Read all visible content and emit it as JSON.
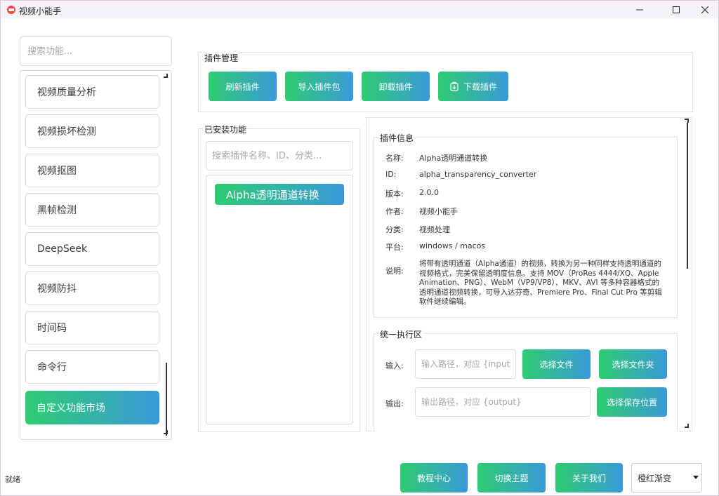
{
  "window": {
    "title": "视频小能手"
  },
  "colors": {
    "accent_start": "#2ecc71",
    "accent_end": "#3a9ad9"
  },
  "sidebar": {
    "search_placeholder": "搜索功能...",
    "items": [
      {
        "label": "视频质量分析"
      },
      {
        "label": "视频损坏检测"
      },
      {
        "label": "视频抠图"
      },
      {
        "label": "黑帧检测"
      },
      {
        "label": "DeepSeek"
      },
      {
        "label": "视频防抖"
      },
      {
        "label": "时间码"
      },
      {
        "label": "命令行"
      },
      {
        "label": "自定义功能市场"
      }
    ]
  },
  "plugin_manage": {
    "title": "插件管理",
    "refresh_label": "刷新插件",
    "import_label": "导入插件包",
    "uninstall_label": "卸载插件",
    "download_label": "下载插件"
  },
  "installed": {
    "title": "已安装功能",
    "search_placeholder": "搜索插件名称、ID、分类...",
    "items": [
      {
        "label": "Alpha透明通道转换"
      }
    ]
  },
  "plugin_info": {
    "title": "插件信息",
    "name_label": "名称:",
    "name_value": "Alpha透明通道转换",
    "id_label": "ID:",
    "id_value": "alpha_transparency_converter",
    "version_label": "版本:",
    "version_value": "2.0.0",
    "author_label": "作者:",
    "author_value": "视频小能手",
    "category_label": "分类:",
    "category_value": "视频处理",
    "platform_label": "平台:",
    "platform_value": "windows / macos",
    "desc_label": "说明:",
    "desc_value": "将带有透明通道（Alpha通道）的视频，转换为另一种同样支持透明通道的视频格式，完美保留透明度信息。支持 MOV（ProRes 4444/XQ、Apple Animation、PNG）、WebM（VP9/VP8）、MKV、AVI 等多种容器格式的透明通道视频转换，可导入达芬奇、Premiere Pro、Final Cut Pro 等剪辑软件继续编辑。"
  },
  "exec": {
    "title": "统一执行区",
    "input_label": "输入:",
    "input_placeholder": "输入路径，对应 {input}",
    "select_file_label": "选择文件",
    "select_folder_label": "选择文件夹",
    "output_label": "输出:",
    "output_placeholder": "输出路径，对应 {output}",
    "select_save_label": "选择保存位置"
  },
  "footer": {
    "status": "就绪",
    "tutorial_label": "教程中心",
    "switch_theme_label": "切换主题",
    "about_label": "关于我们",
    "theme_value": "橙红渐变"
  }
}
